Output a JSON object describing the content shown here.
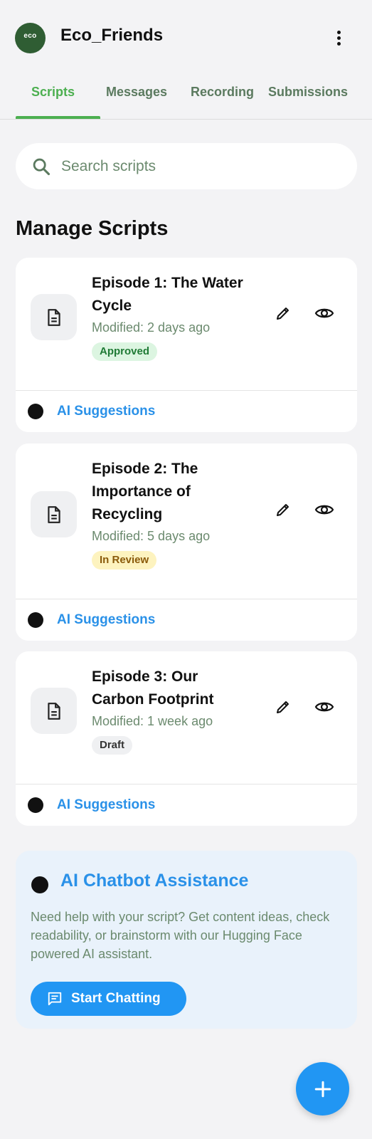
{
  "header": {
    "app_title": "Eco_Friends",
    "logo_text": "eco"
  },
  "tabs": [
    {
      "label": "Scripts",
      "active": true
    },
    {
      "label": "Messages",
      "active": false
    },
    {
      "label": "Recording",
      "active": false
    },
    {
      "label": "Submissions",
      "active": false
    }
  ],
  "search": {
    "placeholder": "Search scripts",
    "value": ""
  },
  "section_title": "Manage Scripts",
  "scripts": [
    {
      "title": "Episode 1: The Water Cycle",
      "modified": "Modified: 2 days ago",
      "status": "Approved",
      "ai_label": "AI Suggestions"
    },
    {
      "title": "Episode 2: The Importance of Recycling",
      "modified": "Modified: 5 days ago",
      "status": "In Review",
      "ai_label": "AI Suggestions"
    },
    {
      "title": "Episode 3: Our Carbon Footprint",
      "modified": "Modified: 1 week ago",
      "status": "Draft",
      "ai_label": "AI Suggestions"
    }
  ],
  "chatbot": {
    "title": "AI Chatbot Assistance",
    "description": "Need help with your script? Get content ideas, check readability, or brainstorm with our Hugging Face powered AI assistant.",
    "button_label": "Start Chatting"
  },
  "colors": {
    "brand_green": "#4caf50",
    "accent_blue": "#2196f3",
    "link_blue": "#2a91e8",
    "approved_bg": "#dcf5e1",
    "review_bg": "#fdf3bf",
    "draft_bg": "#eff0f2"
  },
  "icons": [
    "more-vert-icon",
    "search-icon",
    "document-icon",
    "edit-icon",
    "eye-icon",
    "ai-icon",
    "chat-icon",
    "plus-icon"
  ]
}
